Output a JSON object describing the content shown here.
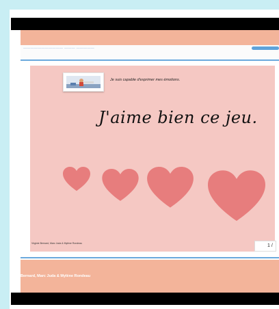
{
  "header": {
    "text": "——————————— ——— —————"
  },
  "slide": {
    "objective": "Je suis capable d'exprimer mes émotions.",
    "phrase": "J'aime bien ce jeu.",
    "credits": "Virginie Bernard, Marc Juda & Mylène Rondeau",
    "page": "1 /"
  },
  "footer": {
    "authors": "Bernard, Marc Juda & Mylène Rondeau"
  },
  "colors": {
    "background": "#c9eef4",
    "salmon": "#f3b49a",
    "slide": "#f5c8c3",
    "heart": "#e77d7d",
    "accent_blue": "#6aa8dc"
  },
  "icons": [
    "thumbnail-image",
    "heart-icon"
  ]
}
